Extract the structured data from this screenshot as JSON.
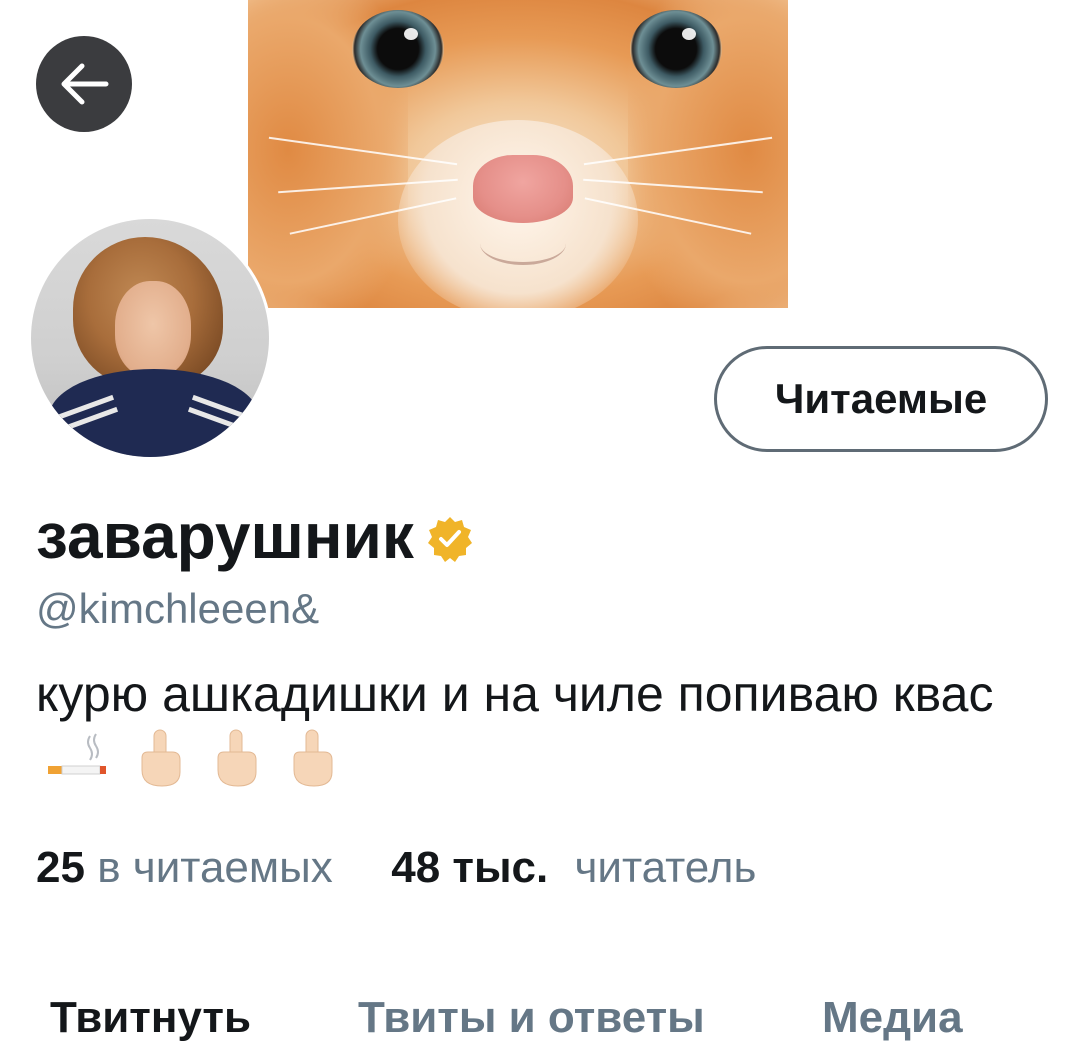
{
  "header": {
    "back_button_icon": "arrow-left-icon",
    "banner_image": "orange-kitten-face"
  },
  "profile": {
    "avatar_image": "curly-haired-person-photo",
    "follow_button_label": "Читаемые",
    "display_name": "заварушник",
    "verified_icon": "verified-badge-icon",
    "verified_color": "#f0b429",
    "handle": "@kimchleeen&",
    "bio_text": "курю ашкадишки и на чиле попиваю квас",
    "bio_emoji": [
      "cigarette-emoji",
      "middle-finger-emoji",
      "middle-finger-emoji",
      "middle-finger-emoji"
    ]
  },
  "stats": {
    "following_count": "25",
    "following_label": "в читаемых",
    "followers_count": "48 тыс.",
    "followers_label": "читатель"
  },
  "tabs": [
    {
      "label": "Твитнуть",
      "active": true
    },
    {
      "label": "Твиты и ответы",
      "active": false
    },
    {
      "label": "Медиа",
      "active": false
    }
  ],
  "colors": {
    "text_primary": "#14171a",
    "text_secondary": "#657786",
    "button_border": "#5f6b75",
    "back_button_bg": "#3b3c3f"
  }
}
